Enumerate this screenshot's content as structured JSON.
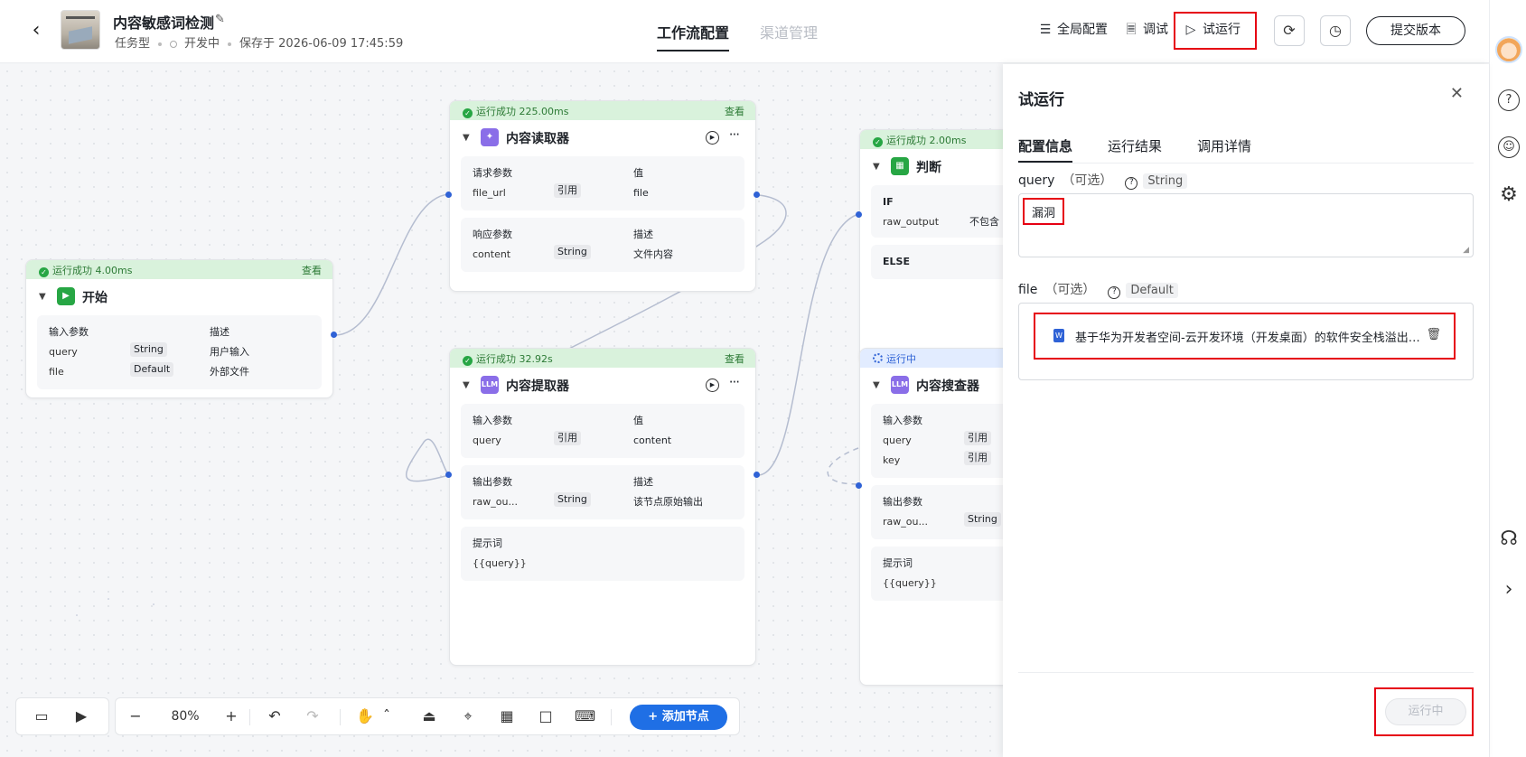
{
  "header": {
    "title": "内容敏感词检测",
    "type": "任务型",
    "status": "开发中",
    "saved": "保存于 2026-06-09 17:45:59",
    "tabs": [
      "工作流配置",
      "渠道管理"
    ],
    "global_config": "全局配置",
    "debug": "调试",
    "trial_run": "试运行",
    "submit": "提交版本"
  },
  "nodes": {
    "start": {
      "status": "运行成功 4.00ms",
      "view": "查看",
      "title": "开始",
      "h1": "输入参数",
      "h2": "描述",
      "rows": [
        {
          "name": "query",
          "type": "String",
          "desc": "用户输入"
        },
        {
          "name": "file",
          "type": "Default",
          "desc": "外部文件"
        }
      ]
    },
    "reader": {
      "status": "运行成功 225.00ms",
      "view": "查看",
      "title": "内容读取器",
      "req_h1": "请求参数",
      "req_h2": "值",
      "req_name": "file_url",
      "req_tag": "引用",
      "req_val": "file",
      "resp_h1": "响应参数",
      "resp_h2": "描述",
      "resp_name": "content",
      "resp_tag": "String",
      "resp_val": "文件内容"
    },
    "extractor": {
      "status": "运行成功 32.92s",
      "view": "查看",
      "title": "内容提取器",
      "in_h1": "输入参数",
      "in_h2": "值",
      "in_name": "query",
      "in_tag": "引用",
      "in_val": "content",
      "out_h1": "输出参数",
      "out_h2": "描述",
      "out_name": "raw_ou...",
      "out_tag": "String",
      "out_val": "该节点原始输出",
      "prompt_h": "提示词",
      "prompt_val": "{{query}}"
    },
    "judge": {
      "status": "运行成功 2.00ms",
      "title": "判断",
      "if": "IF",
      "cond_name": "raw_output",
      "cond_val": "不包含",
      "else": "ELSE"
    },
    "checker": {
      "status": "运行中",
      "title": "内容搜查器",
      "in_h": "输入参数",
      "in_rows": [
        {
          "name": "query",
          "tag": "引用"
        },
        {
          "name": "key",
          "tag": "引用"
        }
      ],
      "out_h": "输出参数",
      "out_name": "raw_ou...",
      "out_tag": "String",
      "prompt_h": "提示词",
      "prompt_val": "{{query}}"
    }
  },
  "toolbar": {
    "zoom": "80%",
    "add_node": "添加节点"
  },
  "panel": {
    "title": "试运行",
    "tabs": [
      "配置信息",
      "运行结果",
      "调用详情"
    ],
    "query_label": "query",
    "query_opt": "（可选）",
    "query_type": "String",
    "query_value": "漏洞",
    "file_label": "file",
    "file_opt": "（可选）",
    "file_type": "Default",
    "file_name": "基于华为开发者空间-云开发环境（开发桌面）的软件安全栈溢出漏洞检测.docx",
    "running": "运行中"
  },
  "colors": {
    "accent": "#1f6fe5",
    "success": "#27a644",
    "highlight": "#e60012"
  }
}
